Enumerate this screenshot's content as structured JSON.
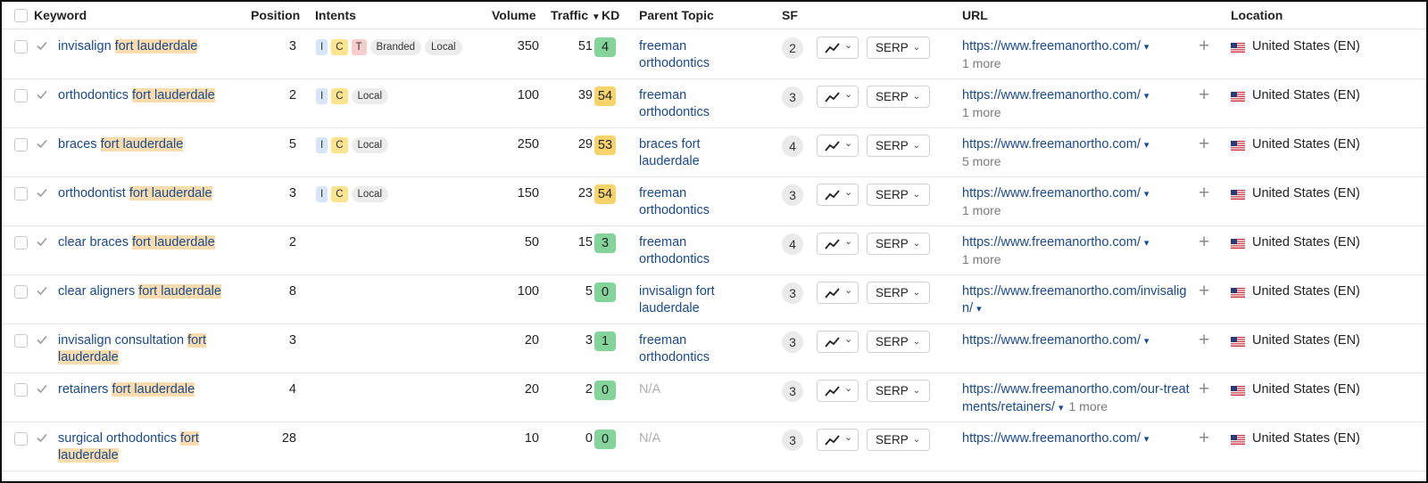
{
  "header": {
    "keyword": "Keyword",
    "position": "Position",
    "intents": "Intents",
    "volume": "Volume",
    "traffic": "Traffic",
    "traffic_sort": "▼",
    "kd": "KD",
    "parent_topic": "Parent Topic",
    "sf": "SF",
    "url": "URL",
    "location": "Location"
  },
  "ui": {
    "serp_label": "SERP",
    "chevron": "⌄",
    "dropdown_arrow": "▾",
    "plus": "+"
  },
  "colors": {
    "link": "#1a4a8c",
    "kd_green": "#84d39a",
    "kd_yellow": "#f8d36c",
    "highlight": "#fbdcae"
  },
  "rows": [
    {
      "kw_pre": "invisalign",
      "kw_hl": "fort lauderdale",
      "position": "3",
      "intents": [
        "I",
        "C",
        "T"
      ],
      "tags": [
        "Branded",
        "Local"
      ],
      "volume": "350",
      "traffic": "51",
      "kd": "4",
      "kd_color": "green",
      "parent": "freeman orthodontics",
      "parent_na": false,
      "sf": "2",
      "url": "https://www.freemanortho.com/",
      "more": "1 more",
      "more_inline": false,
      "location": "United States (EN)"
    },
    {
      "kw_pre": "orthodontics",
      "kw_hl": "fort lauderdale",
      "position": "2",
      "intents": [
        "I",
        "C"
      ],
      "tags": [
        "Local"
      ],
      "volume": "100",
      "traffic": "39",
      "kd": "54",
      "kd_color": "yellow",
      "parent": "freeman orthodontics",
      "parent_na": false,
      "sf": "3",
      "url": "https://www.freemanortho.com/",
      "more": "1 more",
      "more_inline": false,
      "location": "United States (EN)"
    },
    {
      "kw_pre": "braces",
      "kw_hl": "fort lauderdale",
      "position": "5",
      "intents": [
        "I",
        "C"
      ],
      "tags": [
        "Local"
      ],
      "volume": "250",
      "traffic": "29",
      "kd": "53",
      "kd_color": "yellow",
      "parent": "braces fort lauderdale",
      "parent_na": false,
      "sf": "4",
      "url": "https://www.freemanortho.com/",
      "more": "5 more",
      "more_inline": false,
      "location": "United States (EN)"
    },
    {
      "kw_pre": "orthodontist",
      "kw_hl": "fort lauderdale",
      "position": "3",
      "intents": [
        "I",
        "C"
      ],
      "tags": [
        "Local"
      ],
      "volume": "150",
      "traffic": "23",
      "kd": "54",
      "kd_color": "yellow",
      "parent": "freeman orthodontics",
      "parent_na": false,
      "sf": "3",
      "url": "https://www.freemanortho.com/",
      "more": "1 more",
      "more_inline": false,
      "location": "United States (EN)"
    },
    {
      "kw_pre": "clear braces",
      "kw_hl": "fort lauderdale",
      "position": "2",
      "intents": [],
      "tags": [],
      "volume": "50",
      "traffic": "15",
      "kd": "3",
      "kd_color": "green",
      "parent": "freeman orthodontics",
      "parent_na": false,
      "sf": "4",
      "url": "https://www.freemanortho.com/",
      "more": "1 more",
      "more_inline": false,
      "location": "United States (EN)"
    },
    {
      "kw_pre": "clear aligners",
      "kw_hl": "fort lauderdale",
      "position": "8",
      "intents": [],
      "tags": [],
      "volume": "100",
      "traffic": "5",
      "kd": "0",
      "kd_color": "green",
      "parent": "invisalign fort lauderdale",
      "parent_na": false,
      "sf": "3",
      "url": "https://www.freemanortho.com/invisalign/",
      "more": "",
      "more_inline": false,
      "location": "United States (EN)"
    },
    {
      "kw_pre": "invisalign consultation",
      "kw_hl": "fort lauderdale",
      "position": "3",
      "intents": [],
      "tags": [],
      "volume": "20",
      "traffic": "3",
      "kd": "1",
      "kd_color": "green",
      "parent": "freeman orthodontics",
      "parent_na": false,
      "sf": "3",
      "url": "https://www.freemanortho.com/",
      "more": "",
      "more_inline": false,
      "location": "United States (EN)"
    },
    {
      "kw_pre": "retainers",
      "kw_hl": "fort lauderdale",
      "position": "4",
      "intents": [],
      "tags": [],
      "volume": "20",
      "traffic": "2",
      "kd": "0",
      "kd_color": "green",
      "parent": "N/A",
      "parent_na": true,
      "sf": "3",
      "url": "https://www.freemanortho.com/our-treatments/retainers/",
      "more": "1 more",
      "more_inline": true,
      "location": "United States (EN)"
    },
    {
      "kw_pre": "surgical orthodontics",
      "kw_hl": "fort lauderdale",
      "position": "28",
      "intents": [],
      "tags": [],
      "volume": "10",
      "traffic": "0",
      "kd": "0",
      "kd_color": "green",
      "parent": "N/A",
      "parent_na": true,
      "sf": "3",
      "url": "https://www.freemanortho.com/",
      "more": "",
      "more_inline": false,
      "location": "United States (EN)"
    }
  ]
}
